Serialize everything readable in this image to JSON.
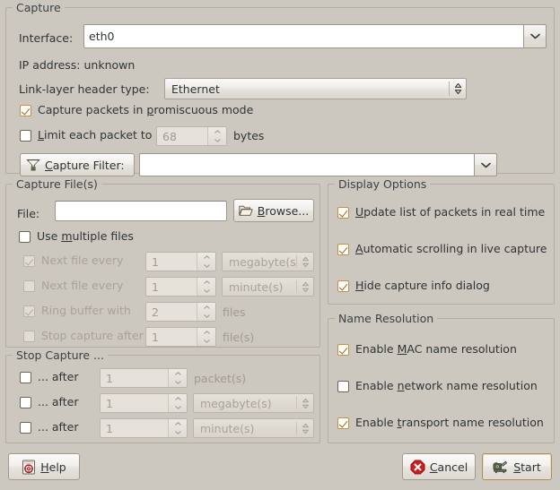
{
  "capture": {
    "title": "Capture",
    "interface_label": "Interface:",
    "interface_value": "eth0",
    "interface_dropdown_icon": "chevron-down-icon",
    "ip_address_text": "IP address: unknown",
    "linklayer_label": "Link-layer header type:",
    "linklayer_value": "Ethernet",
    "linklayer_dropdown_icon": "up-down-arrows-icon",
    "promiscuous": {
      "label_pre": "Capture packets in ",
      "label_mnemonic": "p",
      "label_post": "romiscuous mode",
      "checked": true,
      "enabled": true
    },
    "limit_packet": {
      "label_mnemonic": "L",
      "label_pre": "",
      "label_post": "imit each packet to",
      "checked": false,
      "enabled": true
    },
    "limit_packet_value": "68",
    "limit_packet_units": "bytes",
    "filter_button_label_pre": "",
    "filter_button_mnemonic": "C",
    "filter_button_label_post": "apture Filter:",
    "filter_button_icon": "funnel-filter-icon",
    "filter_value": "",
    "filter_dropdown_icon": "chevron-down-icon"
  },
  "capture_files": {
    "title": "Capture File(s)",
    "file_label": "File:",
    "file_value": "",
    "browse_label_pre": "",
    "browse_mnemonic": "B",
    "browse_label_post": "rowse...",
    "browse_icon": "folder-open-icon",
    "use_multiple": {
      "label_pre": "Use ",
      "label_mnemonic": "m",
      "label_post": "ultiple files",
      "checked": false,
      "enabled": true
    },
    "rows": [
      {
        "name": "next-file-every-size",
        "label": "Next file every",
        "checked": true,
        "enabled": false,
        "value": "1",
        "unit": "megabyte(s)",
        "has_unit_combo": true
      },
      {
        "name": "next-file-every-time",
        "label": "Next file every",
        "checked": false,
        "enabled": false,
        "value": "1",
        "unit": "minute(s)",
        "has_unit_combo": true
      },
      {
        "name": "ring-buffer-with",
        "label": "Ring buffer with",
        "checked": true,
        "enabled": false,
        "value": "2",
        "unit": "files",
        "has_unit_combo": false
      },
      {
        "name": "stop-capture-after-files",
        "label": "Stop capture after",
        "checked": false,
        "enabled": false,
        "value": "1",
        "unit": "file(s)",
        "has_unit_combo": false
      }
    ]
  },
  "stop_capture": {
    "title": "Stop Capture ...",
    "rows": [
      {
        "name": "stop-after-packets",
        "label": "... after",
        "checked": false,
        "enabled": true,
        "value": "1",
        "unit": "packet(s)",
        "has_unit_combo": false
      },
      {
        "name": "stop-after-megabytes",
        "label": "... after",
        "checked": false,
        "enabled": true,
        "value": "1",
        "unit": "megabyte(s)",
        "has_unit_combo": true
      },
      {
        "name": "stop-after-minutes",
        "label": "... after",
        "checked": false,
        "enabled": true,
        "value": "1",
        "unit": "minute(s)",
        "has_unit_combo": true
      }
    ]
  },
  "display_options": {
    "title": "Display Options",
    "items": [
      {
        "name": "update-list-realtime",
        "pre": "",
        "mnemonic": "U",
        "post": "pdate list of packets in real time",
        "checked": true
      },
      {
        "name": "automatic-scrolling",
        "pre": "",
        "mnemonic": "A",
        "post": "utomatic scrolling in live capture",
        "checked": true
      },
      {
        "name": "hide-capture-info-dialog",
        "pre": "",
        "mnemonic": "H",
        "post": "ide capture info dialog",
        "checked": true
      }
    ]
  },
  "name_resolution": {
    "title": "Name Resolution",
    "items": [
      {
        "name": "enable-mac-name-resolution",
        "pre": "Enable ",
        "mnemonic": "M",
        "post": "AC name resolution",
        "checked": true
      },
      {
        "name": "enable-network-name-resolution",
        "pre": "Enable ",
        "mnemonic": "n",
        "post": "etwork name resolution",
        "checked": false
      },
      {
        "name": "enable-transport-name-resolution",
        "pre": "Enable ",
        "mnemonic": "t",
        "post": "ransport name resolution",
        "checked": true
      }
    ]
  },
  "footer": {
    "help_pre": "",
    "help_mnemonic": "H",
    "help_post": "elp",
    "help_icon": "help-lifebuoy-icon",
    "cancel_pre": "",
    "cancel_mnemonic": "C",
    "cancel_post": "ancel",
    "cancel_icon": "cancel-red-octagon-icon",
    "start_pre": "",
    "start_mnemonic": "S",
    "start_post": "tart",
    "start_icon": "network-capture-icon"
  },
  "colors": {
    "window_bg": "#cdc8bf",
    "frame_border": "#b3ada2",
    "text": "#2e3436",
    "disabled_text": "#a8a29a",
    "check_accent": "#c98f3c",
    "default_button_border": "#b08b58",
    "cancel_red": "#cc1f1f"
  }
}
